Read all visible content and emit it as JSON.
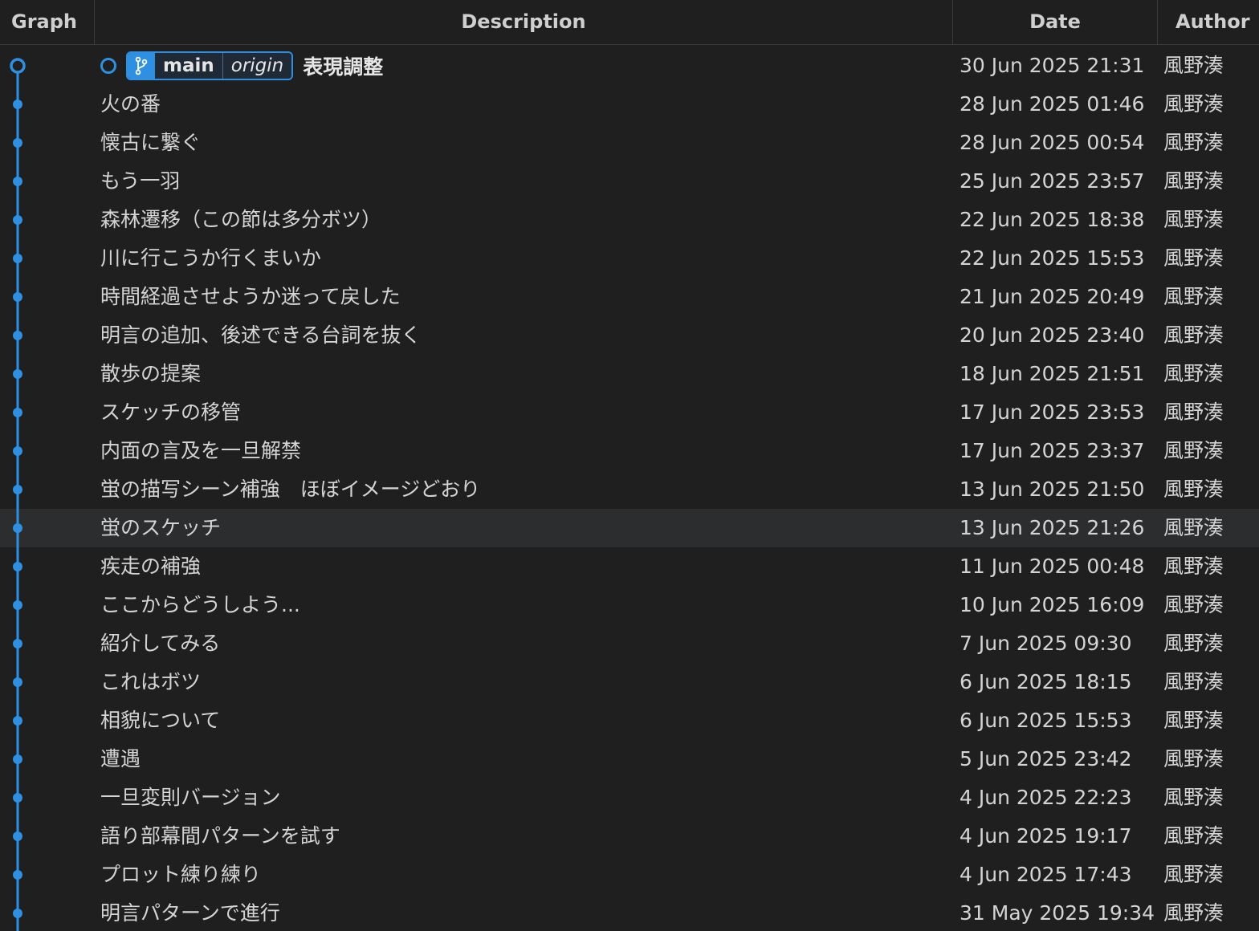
{
  "header": {
    "graph": "Graph",
    "description": "Description",
    "date": "Date",
    "author": "Author"
  },
  "head": {
    "branch": "main",
    "remote": "origin",
    "message": "表現調整",
    "date": "30 Jun 2025 21:31",
    "author": "風野湊"
  },
  "colors": {
    "graph_line": "#2f8fe0",
    "selected_row": "#2b2d2e"
  },
  "selected_index": 12,
  "commits": [
    {
      "message": "火の番",
      "date": "28 Jun 2025 01:46",
      "author": "風野湊"
    },
    {
      "message": "懐古に繋ぐ",
      "date": "28 Jun 2025 00:54",
      "author": "風野湊"
    },
    {
      "message": "もう一羽",
      "date": "25 Jun 2025 23:57",
      "author": "風野湊"
    },
    {
      "message": "森林遷移（この節は多分ボツ）",
      "date": "22 Jun 2025 18:38",
      "author": "風野湊"
    },
    {
      "message": "川に行こうか行くまいか",
      "date": "22 Jun 2025 15:53",
      "author": "風野湊"
    },
    {
      "message": "時間経過させようか迷って戻した",
      "date": "21 Jun 2025 20:49",
      "author": "風野湊"
    },
    {
      "message": "明言の追加、後述できる台詞を抜く",
      "date": "20 Jun 2025 23:40",
      "author": "風野湊"
    },
    {
      "message": "散歩の提案",
      "date": "18 Jun 2025 21:51",
      "author": "風野湊"
    },
    {
      "message": "スケッチの移管",
      "date": "17 Jun 2025 23:53",
      "author": "風野湊"
    },
    {
      "message": "内面の言及を一旦解禁",
      "date": "17 Jun 2025 23:37",
      "author": "風野湊"
    },
    {
      "message": "蛍の描写シーン補強　ほぼイメージどおり",
      "date": "13 Jun 2025 21:50",
      "author": "風野湊"
    },
    {
      "message": "蛍のスケッチ",
      "date": "13 Jun 2025 21:26",
      "author": "風野湊"
    },
    {
      "message": "疾走の補強",
      "date": "11 Jun 2025 00:48",
      "author": "風野湊"
    },
    {
      "message": "ここからどうしよう...",
      "date": "10 Jun 2025 16:09",
      "author": "風野湊"
    },
    {
      "message": "紹介してみる",
      "date": "7 Jun 2025 09:30",
      "author": "風野湊"
    },
    {
      "message": "これはボツ",
      "date": "6 Jun 2025 18:15",
      "author": "風野湊"
    },
    {
      "message": "相貌について",
      "date": "6 Jun 2025 15:53",
      "author": "風野湊"
    },
    {
      "message": "遭遇",
      "date": "5 Jun 2025 23:42",
      "author": "風野湊"
    },
    {
      "message": "一旦変則バージョン",
      "date": "4 Jun 2025 22:23",
      "author": "風野湊"
    },
    {
      "message": "語り部幕間パターンを試す",
      "date": "4 Jun 2025 19:17",
      "author": "風野湊"
    },
    {
      "message": "プロット練り練り",
      "date": "4 Jun 2025 17:43",
      "author": "風野湊"
    },
    {
      "message": "明言パターンで進行",
      "date": "31 May 2025 19:34",
      "author": "風野湊"
    }
  ]
}
